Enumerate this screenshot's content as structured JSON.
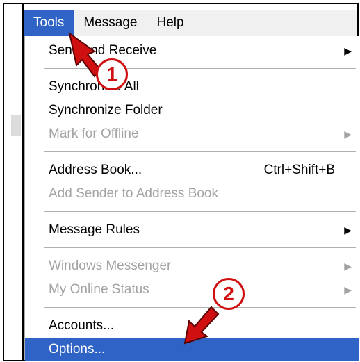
{
  "menubar": {
    "items": [
      {
        "label": "Tools",
        "active": true
      },
      {
        "label": "Message",
        "active": false
      },
      {
        "label": "Help",
        "active": false
      }
    ]
  },
  "menu": {
    "items": [
      {
        "label": "Send and Receive",
        "shortcut": "",
        "submenu": true,
        "disabled": false
      },
      {
        "label": "Synchronize All",
        "shortcut": "",
        "submenu": false,
        "disabled": false
      },
      {
        "label": "Synchronize Folder",
        "shortcut": "",
        "submenu": false,
        "disabled": false
      },
      {
        "label": "Mark for Offline",
        "shortcut": "",
        "submenu": true,
        "disabled": true
      },
      {
        "label": "Address Book...",
        "shortcut": "Ctrl+Shift+B",
        "submenu": false,
        "disabled": false
      },
      {
        "label": "Add Sender to Address Book",
        "shortcut": "",
        "submenu": false,
        "disabled": true
      },
      {
        "label": "Message Rules",
        "shortcut": "",
        "submenu": true,
        "disabled": false
      },
      {
        "label": "Windows Messenger",
        "shortcut": "",
        "submenu": true,
        "disabled": true
      },
      {
        "label": "My Online Status",
        "shortcut": "",
        "submenu": true,
        "disabled": true
      },
      {
        "label": "Accounts...",
        "shortcut": "",
        "submenu": false,
        "disabled": false
      },
      {
        "label": "Options...",
        "shortcut": "",
        "submenu": false,
        "disabled": false,
        "highlighted": true
      }
    ]
  },
  "annotations": {
    "step1": "1",
    "step2": "2",
    "color": "#d01010"
  },
  "colors": {
    "highlight": "#2f64c6",
    "disabled_text": "#a3a3a3"
  },
  "icons": {
    "submenu_arrow": "triangle-right-icon"
  }
}
